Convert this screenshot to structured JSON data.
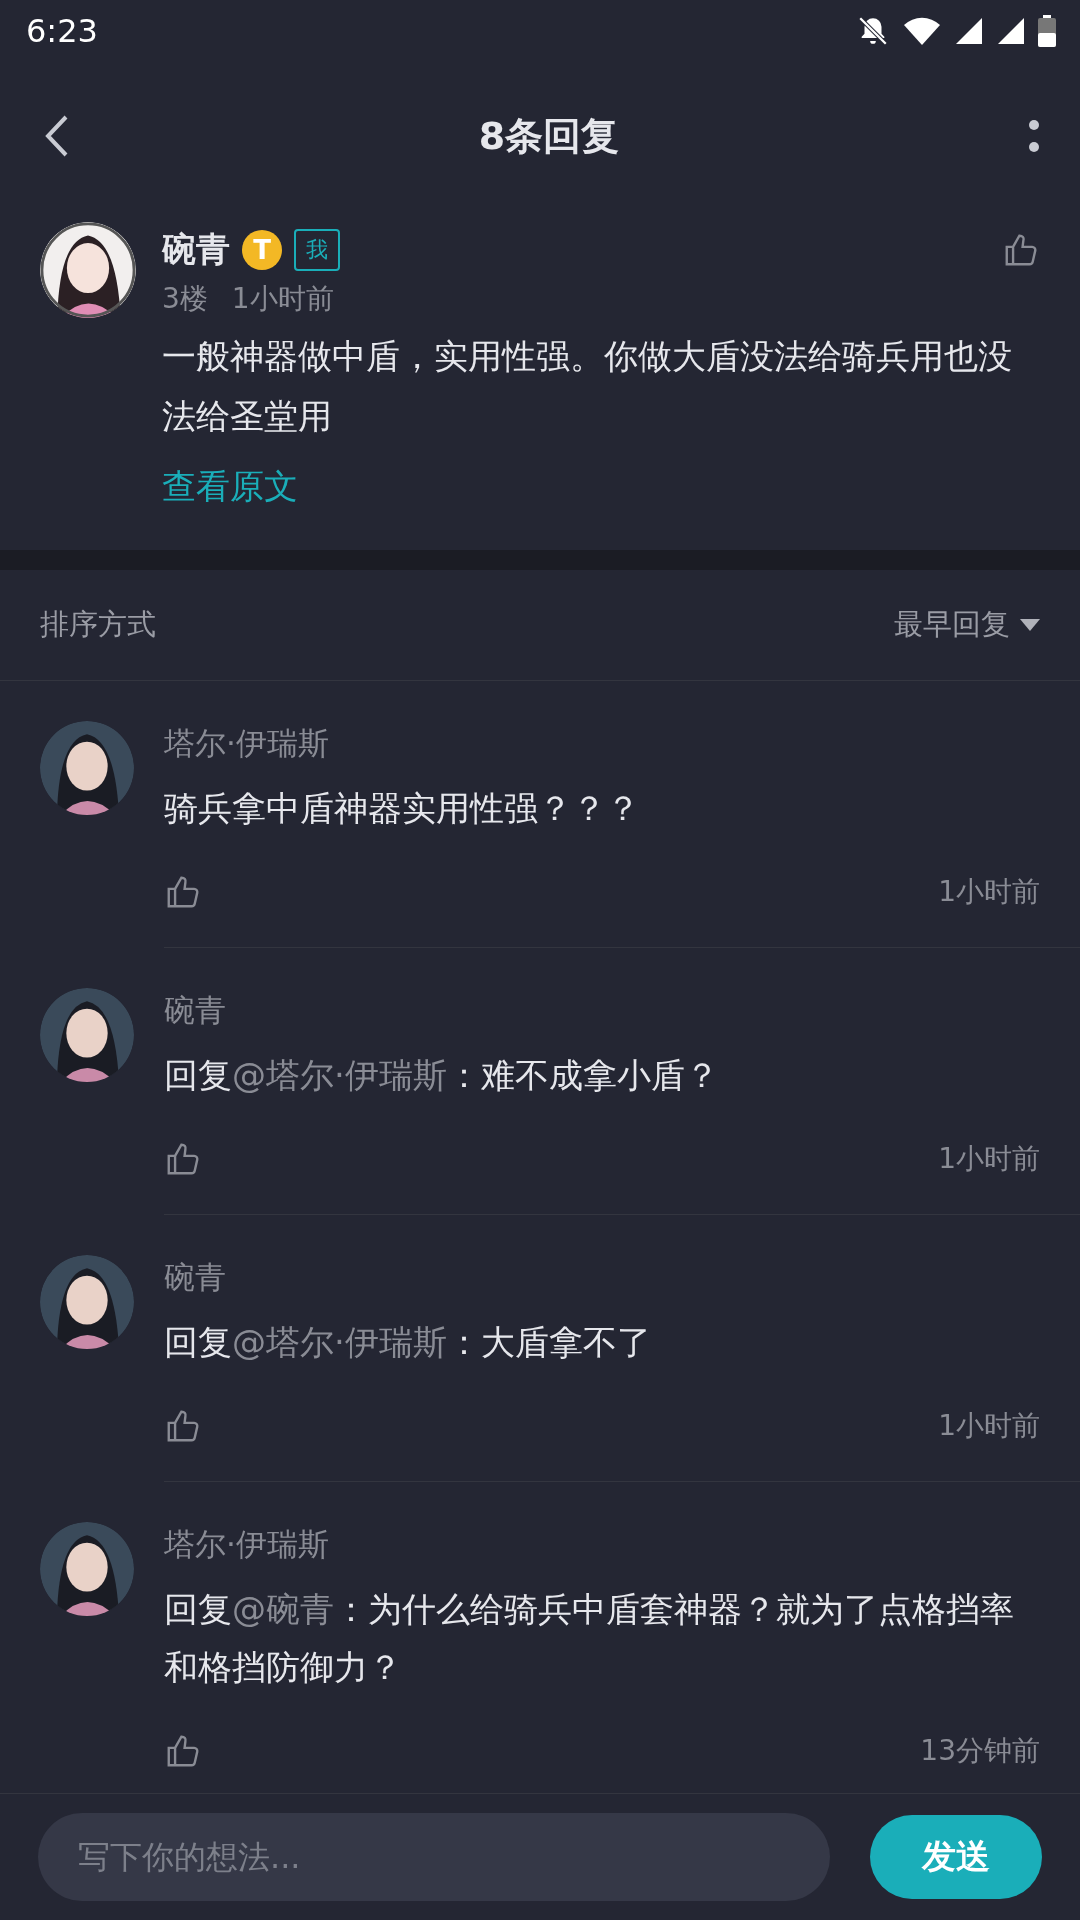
{
  "status_bar": {
    "time": "6:23"
  },
  "header": {
    "title": "8条回复"
  },
  "comment": {
    "author": "碗青",
    "level_badge": "T",
    "tag": "我",
    "floor": "3楼",
    "time": "1小时前",
    "text": "一般神器做中盾，实用性强。你做大盾没法给骑兵用也没法给圣堂用",
    "link": "查看原文"
  },
  "sort": {
    "label": "排序方式",
    "value": "最早回复"
  },
  "replies": [
    {
      "author": "塔尔·伊瑞斯",
      "text": "骑兵拿中盾神器实用性强？？？",
      "time": "1小时前"
    },
    {
      "author": "碗青",
      "prefix": "回复",
      "mention": "@塔尔·伊瑞斯",
      "text": "：难不成拿小盾？",
      "time": "1小时前"
    },
    {
      "author": "碗青",
      "prefix": "回复",
      "mention": "@塔尔·伊瑞斯",
      "text": "：大盾拿不了",
      "time": "1小时前"
    },
    {
      "author": "塔尔·伊瑞斯",
      "prefix": "回复",
      "mention": "@碗青",
      "text": "：为什么给骑兵中盾套神器？就为了点格挡率和格挡防御力？",
      "time": "13分钟前"
    }
  ],
  "composer": {
    "placeholder": "写下你的想法...",
    "send": "发送"
  }
}
